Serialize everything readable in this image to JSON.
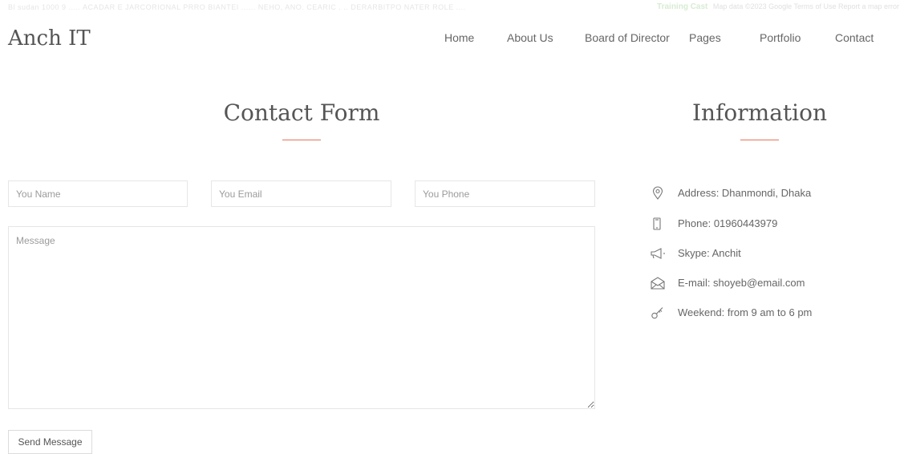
{
  "top_strip": {
    "faint_text": "Bl sudan 1000 9    ..... ACADAR E JARCORIONAL PRRO BIANTEI ...... NEHO, ANO. CEARIC   .   .. DERARBITPO NATER ROLE ....",
    "highlight": "Training Cast",
    "right_text": "Map data ©2023 Google   Terms of Use   Report a map error"
  },
  "brand": {
    "logo": "Anch IT"
  },
  "nav": {
    "items": [
      {
        "label": "Home"
      },
      {
        "label": "About Us"
      },
      {
        "label": "Board of Director"
      },
      {
        "label": "Pages"
      },
      {
        "label": "Portfolio"
      },
      {
        "label": "Contact"
      }
    ]
  },
  "contact_form": {
    "title": "Contact Form",
    "name_placeholder": "You Name",
    "email_placeholder": "You Email",
    "phone_placeholder": "You Phone",
    "message_placeholder": "Message",
    "submit_label": "Send Message"
  },
  "information": {
    "title": "Information",
    "items": [
      {
        "icon": "map-pin-icon",
        "text": "Address: Dhanmondi, Dhaka"
      },
      {
        "icon": "phone-icon",
        "text": "Phone: 01960443979"
      },
      {
        "icon": "megaphone-icon",
        "text": "Skype: Anchit"
      },
      {
        "icon": "envelope-icon",
        "text": "E-mail: shoyeb@email.com"
      },
      {
        "icon": "key-icon",
        "text": "Weekend: from 9 am to 6 pm"
      }
    ]
  },
  "colors": {
    "accent": "#e8735a",
    "text": "#555555",
    "border": "#e6e6e6"
  }
}
